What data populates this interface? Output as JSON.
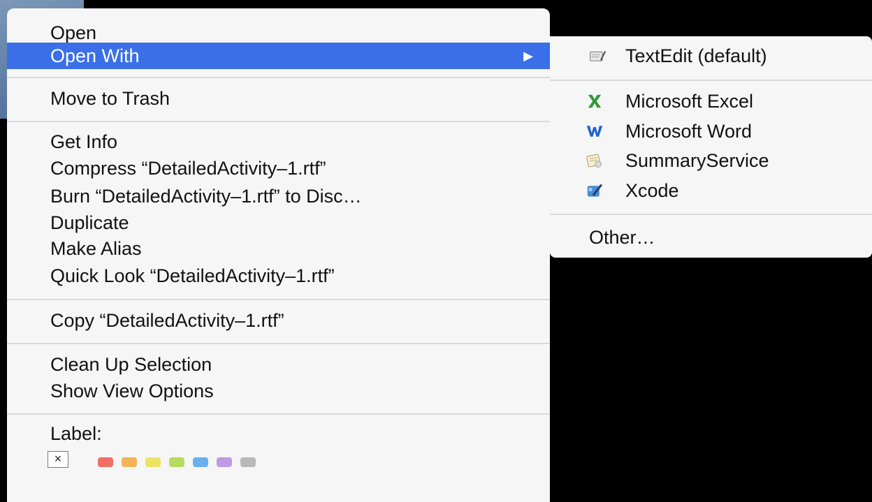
{
  "context_menu": {
    "items": [
      {
        "label": "Open"
      },
      {
        "label": "Open With",
        "submenu_arrow": "▶"
      },
      {
        "label": "Move to Trash"
      },
      {
        "label": "Get Info"
      },
      {
        "label": "Compress “DetailedActivity–1.rtf”"
      },
      {
        "label": "Burn “DetailedActivity–1.rtf” to Disc…"
      },
      {
        "label": "Duplicate"
      },
      {
        "label": "Make Alias"
      },
      {
        "label": "Quick Look “DetailedActivity–1.rtf”"
      },
      {
        "label": "Copy “DetailedActivity–1.rtf”"
      },
      {
        "label": "Clean Up Selection"
      },
      {
        "label": "Show View Options"
      },
      {
        "label": "Label:"
      }
    ],
    "label_colors": {
      "none_symbol": "×",
      "swatches": [
        {
          "name": "red",
          "color": "#ef6f67"
        },
        {
          "name": "orange",
          "color": "#f4b45a"
        },
        {
          "name": "yellow",
          "color": "#ede265"
        },
        {
          "name": "green",
          "color": "#b6da62"
        },
        {
          "name": "blue",
          "color": "#69b0ee"
        },
        {
          "name": "purple",
          "color": "#c19ae6"
        },
        {
          "name": "gray",
          "color": "#b9b9b9"
        }
      ]
    },
    "highlight_color": "#3a6fe8"
  },
  "open_with_submenu": {
    "items": [
      {
        "label": "TextEdit (default)",
        "icon": "textedit-icon"
      },
      {
        "label": "Microsoft Excel",
        "icon": "excel-icon"
      },
      {
        "label": "Microsoft Word",
        "icon": "word-icon"
      },
      {
        "label": "SummaryService",
        "icon": "summaryservice-icon"
      },
      {
        "label": "Xcode",
        "icon": "xcode-icon"
      },
      {
        "label": "Other…"
      }
    ]
  }
}
